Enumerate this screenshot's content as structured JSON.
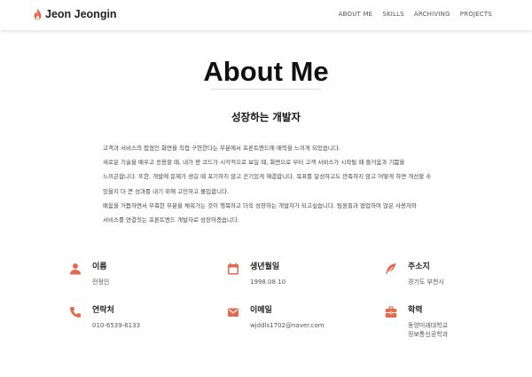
{
  "brand": {
    "name": "Jeon Jeongin",
    "icon": "fire-icon"
  },
  "nav": [
    "ABOUT ME",
    "SKILLS",
    "ARCHIVING",
    "PROJECTS"
  ],
  "section": {
    "title": "About Me",
    "subtitle": "성장하는 개발자",
    "intro": [
      "고객과 서비스의 접점인 화면을 직접 구현한다는 부분에서 프론트엔드에 매력을 느끼게 되었습니다.",
      "새로운 기술을 배우고 응용할 때, 내가 짠 코드가 시각적으로 보일 때, 화면으로 부터 고객 서비스가 시작될 때 즐거움과 기쁨을",
      "느끼곤합니다. 또한, 개발에 문제가 생길 때 포기하지 않고 끈기있게 해결합니다. 목표를 달성하고도 만족하지 않고 어떻게 하면 개선할 수",
      "있을지 더 큰 성과를 내기 위해 고민하고 몰입합니다.",
      "배움을 거듭하면서 부족한 부분을 채워가는 것이 행복하고 더욱 성장하는 개발자가 되고싶습니다. 팀원들과 협업하여 많은 사용자와",
      "서비스를 연결짓는 프론트엔드 개발자로 성장하겠습니다."
    ]
  },
  "info": [
    {
      "icon": "person-icon",
      "label": "이름",
      "values": [
        "전정인"
      ]
    },
    {
      "icon": "calendar-icon",
      "label": "생년월일",
      "values": [
        "1998.08.10"
      ]
    },
    {
      "icon": "map-pin-icon",
      "label": "주소지",
      "values": [
        "경기도 부천시"
      ]
    },
    {
      "icon": "phone-icon",
      "label": "연락처",
      "values": [
        "010-6539-6133"
      ]
    },
    {
      "icon": "email-icon",
      "label": "이메일",
      "values": [
        "wjddls1702@naver.com"
      ]
    },
    {
      "icon": "briefcase-icon",
      "label": "학력",
      "values": [
        "동양미래대학교",
        "정보통신공학과"
      ]
    }
  ],
  "colors": {
    "accent": "#e46a4c",
    "text": "#222222"
  }
}
